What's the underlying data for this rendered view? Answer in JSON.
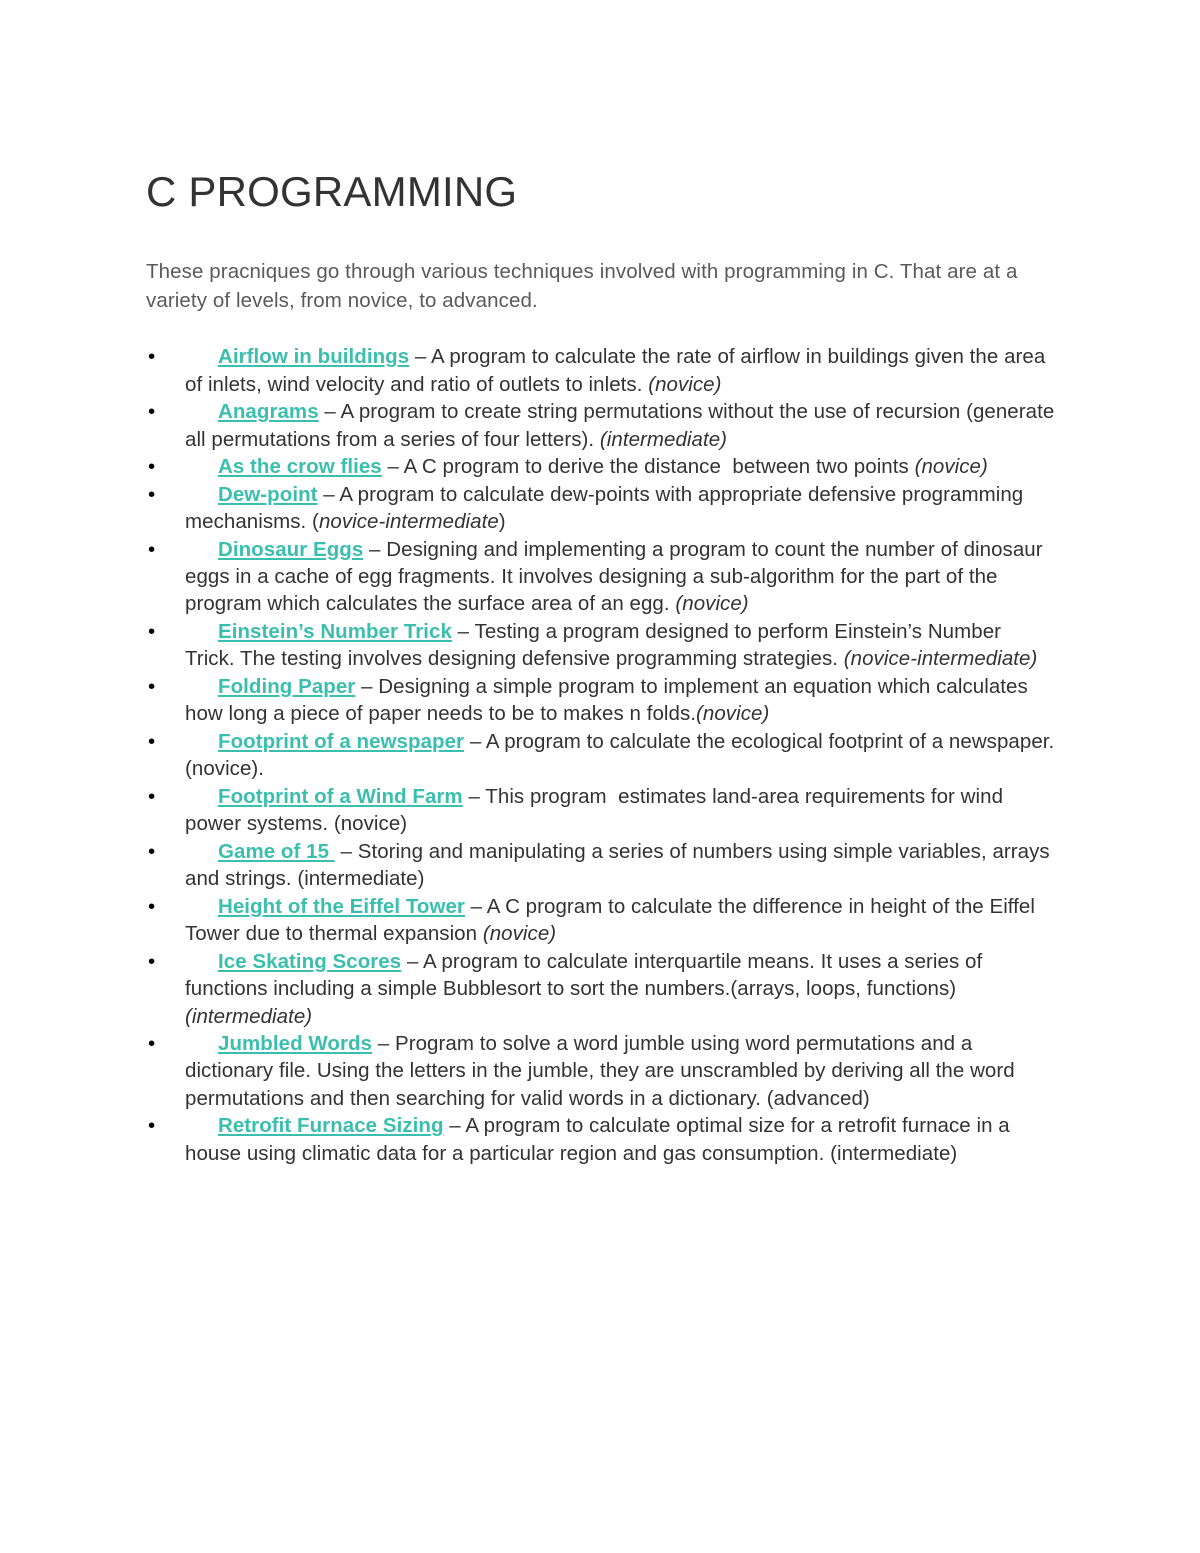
{
  "document": {
    "title": "C PROGRAMMING",
    "intro": "These pracniques go through various techniques involved with programming in C. That are at a variety of levels, from novice, to advanced.",
    "bullet_glyph": "•",
    "dash": " – ",
    "link_color": "#3ABFAE",
    "title_color": "#333333",
    "body_color": "#333333",
    "intro_color": "#5A5A5A",
    "items": [
      {
        "link": "Airflow in buildings",
        "body": "A program to calculate the rate of airflow in buildings given the area of inlets, wind velocity and ratio of outlets to inlets. ",
        "level": "(novice)"
      },
      {
        "link": "Anagrams",
        "body": "A program to create string permutations without the use of recursion (generate all permutations from a series of four letters). ",
        "level": "(intermediate)"
      },
      {
        "link": "As the crow flies",
        "body": "A C program to derive the distance  between two points ",
        "level": "(novice)"
      },
      {
        "link": "Dew-point",
        "body": "A program to calculate dew-points with appropriate defensive programming mechanisms. (",
        "level": "novice-intermediate",
        "level_suffix": ")"
      },
      {
        "link": "Dinosaur Eggs",
        "body": "Designing and implementing a program to count the number of dinosaur eggs in a cache of egg fragments. It involves designing a sub-algorithm for the part of the program which calculates the surface area of an egg. ",
        "level": "(novice)"
      },
      {
        "link": "Einstein’s Number Trick",
        "body": "Testing a program designed to perform Einstein’s Number Trick. The testing involves designing defensive programming strategies. ",
        "level": "(novice-intermediate)"
      },
      {
        "link": "Folding Paper",
        "body": "Designing a simple program to implement an equation which calculates how long a piece of paper needs to be to makes n folds.",
        "level": "(novice)"
      },
      {
        "link": "Footprint of a newspaper",
        "body": "A program to calculate the ecological footprint of a newspaper. (novice).",
        "level": ""
      },
      {
        "link": "Footprint of a Wind Farm",
        "body": "This program  estimates land-area requirements for wind power systems. (novice)",
        "level": ""
      },
      {
        "link": "Game of 15 ",
        "body": "Storing and manipulating a series of numbers using simple variables, arrays and strings. (intermediate)",
        "level": ""
      },
      {
        "link": "Height of the Eiffel Tower",
        "body": "A C program to calculate the difference in height of the Eiffel Tower due to thermal expansion ",
        "level": "(novice)"
      },
      {
        "link": "Ice Skating Scores",
        "body": "A program to calculate interquartile means. It uses a series of functions including a simple Bubblesort to sort the numbers.(arrays, loops, functions) ",
        "level": "(intermediate)"
      },
      {
        "link": "Jumbled Words",
        "body": "Program to solve a word jumble using word permutations and a dictionary file. Using the letters in the jumble, they are unscrambled by deriving all the word permutations and then searching for valid words in a dictionary. (advanced)",
        "level": ""
      },
      {
        "link": "Retrofit Furnace Sizing",
        "body": "A program to calculate optimal size for a retrofit furnace in a house using climatic data for a particular region and gas consumption. (intermediate)",
        "level": ""
      }
    ]
  }
}
